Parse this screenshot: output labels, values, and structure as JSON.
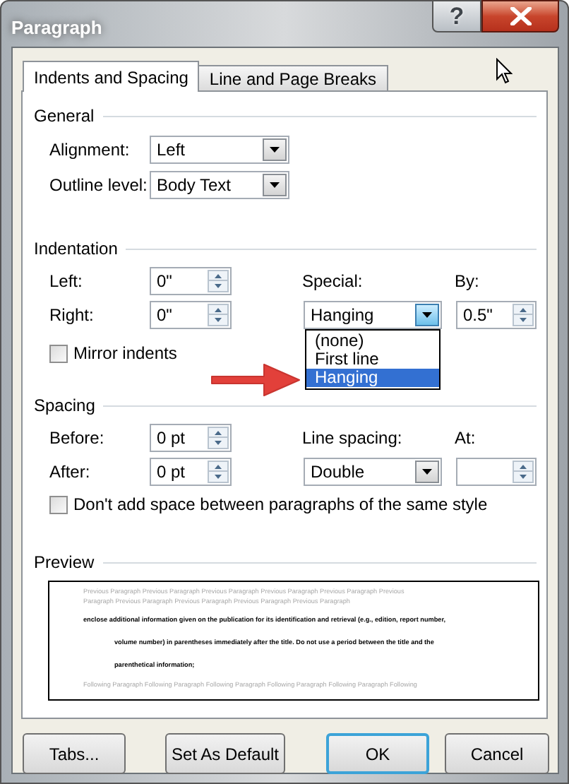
{
  "window": {
    "title": "Paragraph",
    "help": "?"
  },
  "tabs": [
    {
      "label": "Indents and Spacing",
      "selected": true
    },
    {
      "label": "Line and Page Breaks",
      "selected": false
    }
  ],
  "general": {
    "heading": "General",
    "alignment": {
      "label": "Alignment:",
      "value": "Left"
    },
    "outline_level": {
      "label": "Outline level:",
      "value": "Body Text"
    }
  },
  "indentation": {
    "heading": "Indentation",
    "left": {
      "label": "Left:",
      "value": "0\""
    },
    "right": {
      "label": "Right:",
      "value": "0\""
    },
    "special": {
      "label": "Special:",
      "value": "Hanging",
      "expanded": true,
      "options": [
        {
          "label": "(none)",
          "selected": false
        },
        {
          "label": "First line",
          "selected": false
        },
        {
          "label": "Hanging",
          "selected": true
        }
      ]
    },
    "by": {
      "label": "By:",
      "value": "0.5\""
    },
    "mirror_indents": {
      "label": "Mirror indents",
      "checked": false
    }
  },
  "spacing": {
    "heading": "Spacing",
    "before": {
      "label": "Before:",
      "value": "0 pt"
    },
    "after": {
      "label": "After:",
      "value": "0 pt"
    },
    "line_spacing": {
      "label": "Line spacing:",
      "value": "Double"
    },
    "at": {
      "label": "At:"
    },
    "dont_add_space": {
      "label": "Don't add space between paragraphs of the same style",
      "checked": false
    }
  },
  "preview": {
    "heading": "Preview",
    "previous_lines": [
      "Previous Paragraph Previous Paragraph Previous Paragraph Previous Paragraph Previous Paragraph Previous",
      "Paragraph Previous Paragraph Previous Paragraph Previous Paragraph Previous Paragraph"
    ],
    "body_lines": [
      "enclose additional information given on the publication for its identification and retrieval (e.g., edition, report number,",
      "volume number) in parentheses immediately after the title. Do not use a period between the title and the",
      "parenthetical information;"
    ],
    "following_lines": [
      "Following Paragraph Following Paragraph Following Paragraph Following Paragraph Following Paragraph Following"
    ]
  },
  "buttons": [
    {
      "label": "Tabs...",
      "default": false
    },
    {
      "label": "Set As Default",
      "default": false
    },
    {
      "label": "OK",
      "default": true
    },
    {
      "label": "Cancel",
      "default": false
    }
  ]
}
